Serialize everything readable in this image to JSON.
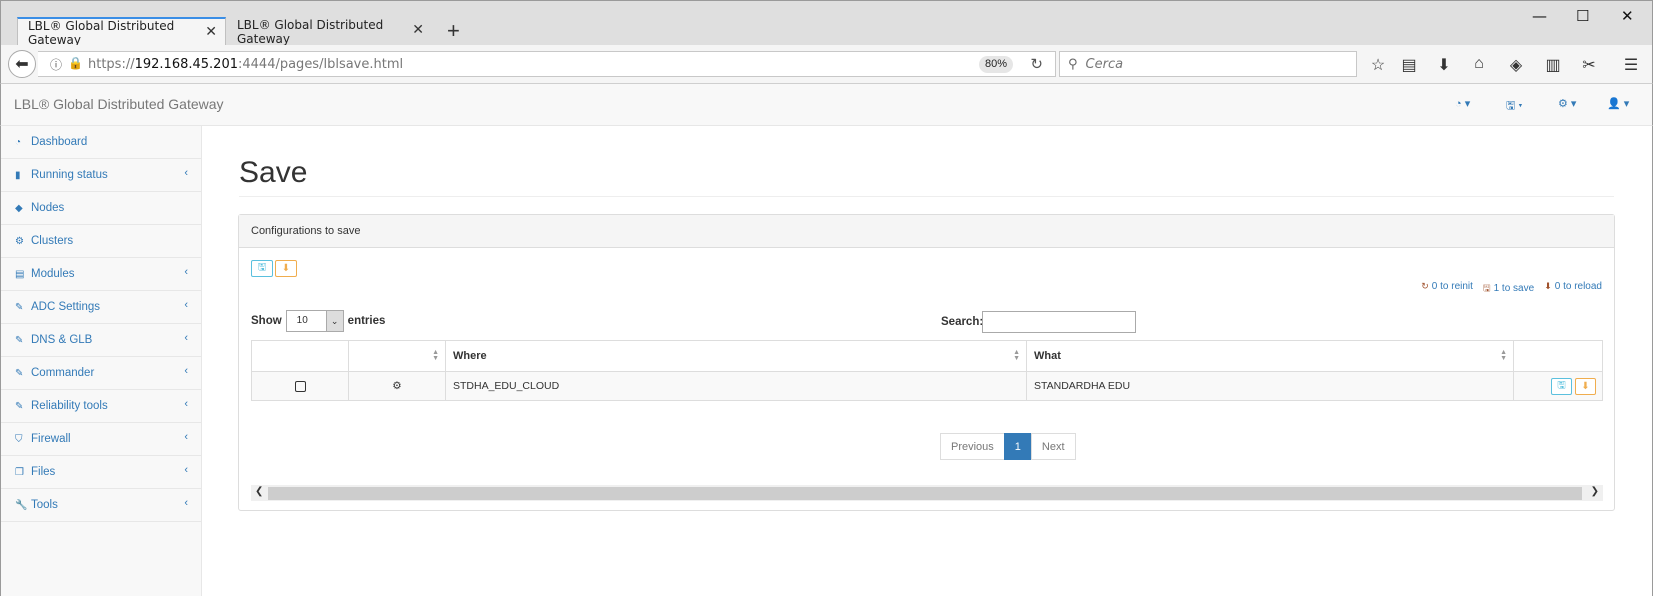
{
  "browser": {
    "tabs": [
      {
        "label": "LBL® Global Distributed Gateway"
      },
      {
        "label": "LBL® Global Distributed Gateway"
      }
    ],
    "url_prefix": "https://",
    "url_host": "192.168.45.201",
    "url_path": ":4444/pages/lblsave.html",
    "zoom": "80%",
    "search_placeholder": "Cerca"
  },
  "app": {
    "brand": "LBL® Global Distributed Gateway"
  },
  "sidebar": {
    "items": [
      {
        "label": "Dashboard",
        "icon": "dashboard-icon"
      },
      {
        "label": "Running status",
        "icon": "bar-chart-icon"
      },
      {
        "label": "Nodes",
        "icon": "cube-icon"
      },
      {
        "label": "Clusters",
        "icon": "cogs-icon"
      },
      {
        "label": "Modules",
        "icon": "list-icon"
      },
      {
        "label": "ADC Settings",
        "icon": "edit-icon"
      },
      {
        "label": "DNS & GLB",
        "icon": "edit-icon"
      },
      {
        "label": "Commander",
        "icon": "edit-icon"
      },
      {
        "label": "Reliability tools",
        "icon": "edit-icon"
      },
      {
        "label": "Firewall",
        "icon": "shield-icon"
      },
      {
        "label": "Files",
        "icon": "files-icon"
      },
      {
        "label": "Tools",
        "icon": "wrench-icon"
      }
    ]
  },
  "main": {
    "title": "Save",
    "panel_title": "Configurations to save",
    "counts": {
      "reinit": "0 to reinit",
      "save": "1 to save",
      "reload": "0 to reload"
    },
    "show_label": "Show",
    "entries_value": "10",
    "entries_label": "entries",
    "search_label": "Search:",
    "table": {
      "headers": [
        "",
        "",
        "Where",
        "What",
        ""
      ],
      "rows": [
        {
          "where": "STDHA_EDU_CLOUD",
          "what": "STANDARDHA EDU"
        }
      ]
    },
    "pager": {
      "previous": "Previous",
      "page": "1",
      "next": "Next"
    }
  }
}
